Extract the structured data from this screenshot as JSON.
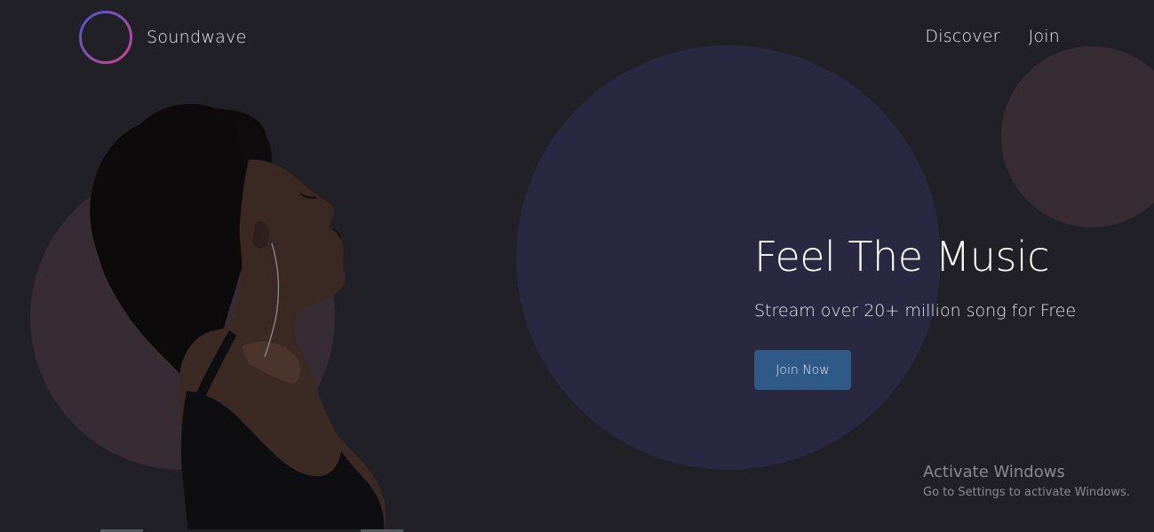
{
  "brand": {
    "name": "Soundwave",
    "logo_icon": "soundwave-logo-icon"
  },
  "nav": {
    "items": [
      {
        "label": "Discover"
      },
      {
        "label": "Join"
      }
    ]
  },
  "hero": {
    "title": "Feel The Music",
    "subtitle": "Stream over 20+ million song for Free",
    "cta_label": "Join Now"
  },
  "watermark": {
    "title": "Activate Windows",
    "subtitle": "Go to Settings to activate Windows."
  },
  "colors": {
    "background": "#202026",
    "accent_circle": "#2a2740",
    "muted_circle": "#382c34",
    "button": "#2f5a87",
    "logo_gradient_start": "#4b57d4",
    "logo_gradient_end": "#d0458c"
  }
}
